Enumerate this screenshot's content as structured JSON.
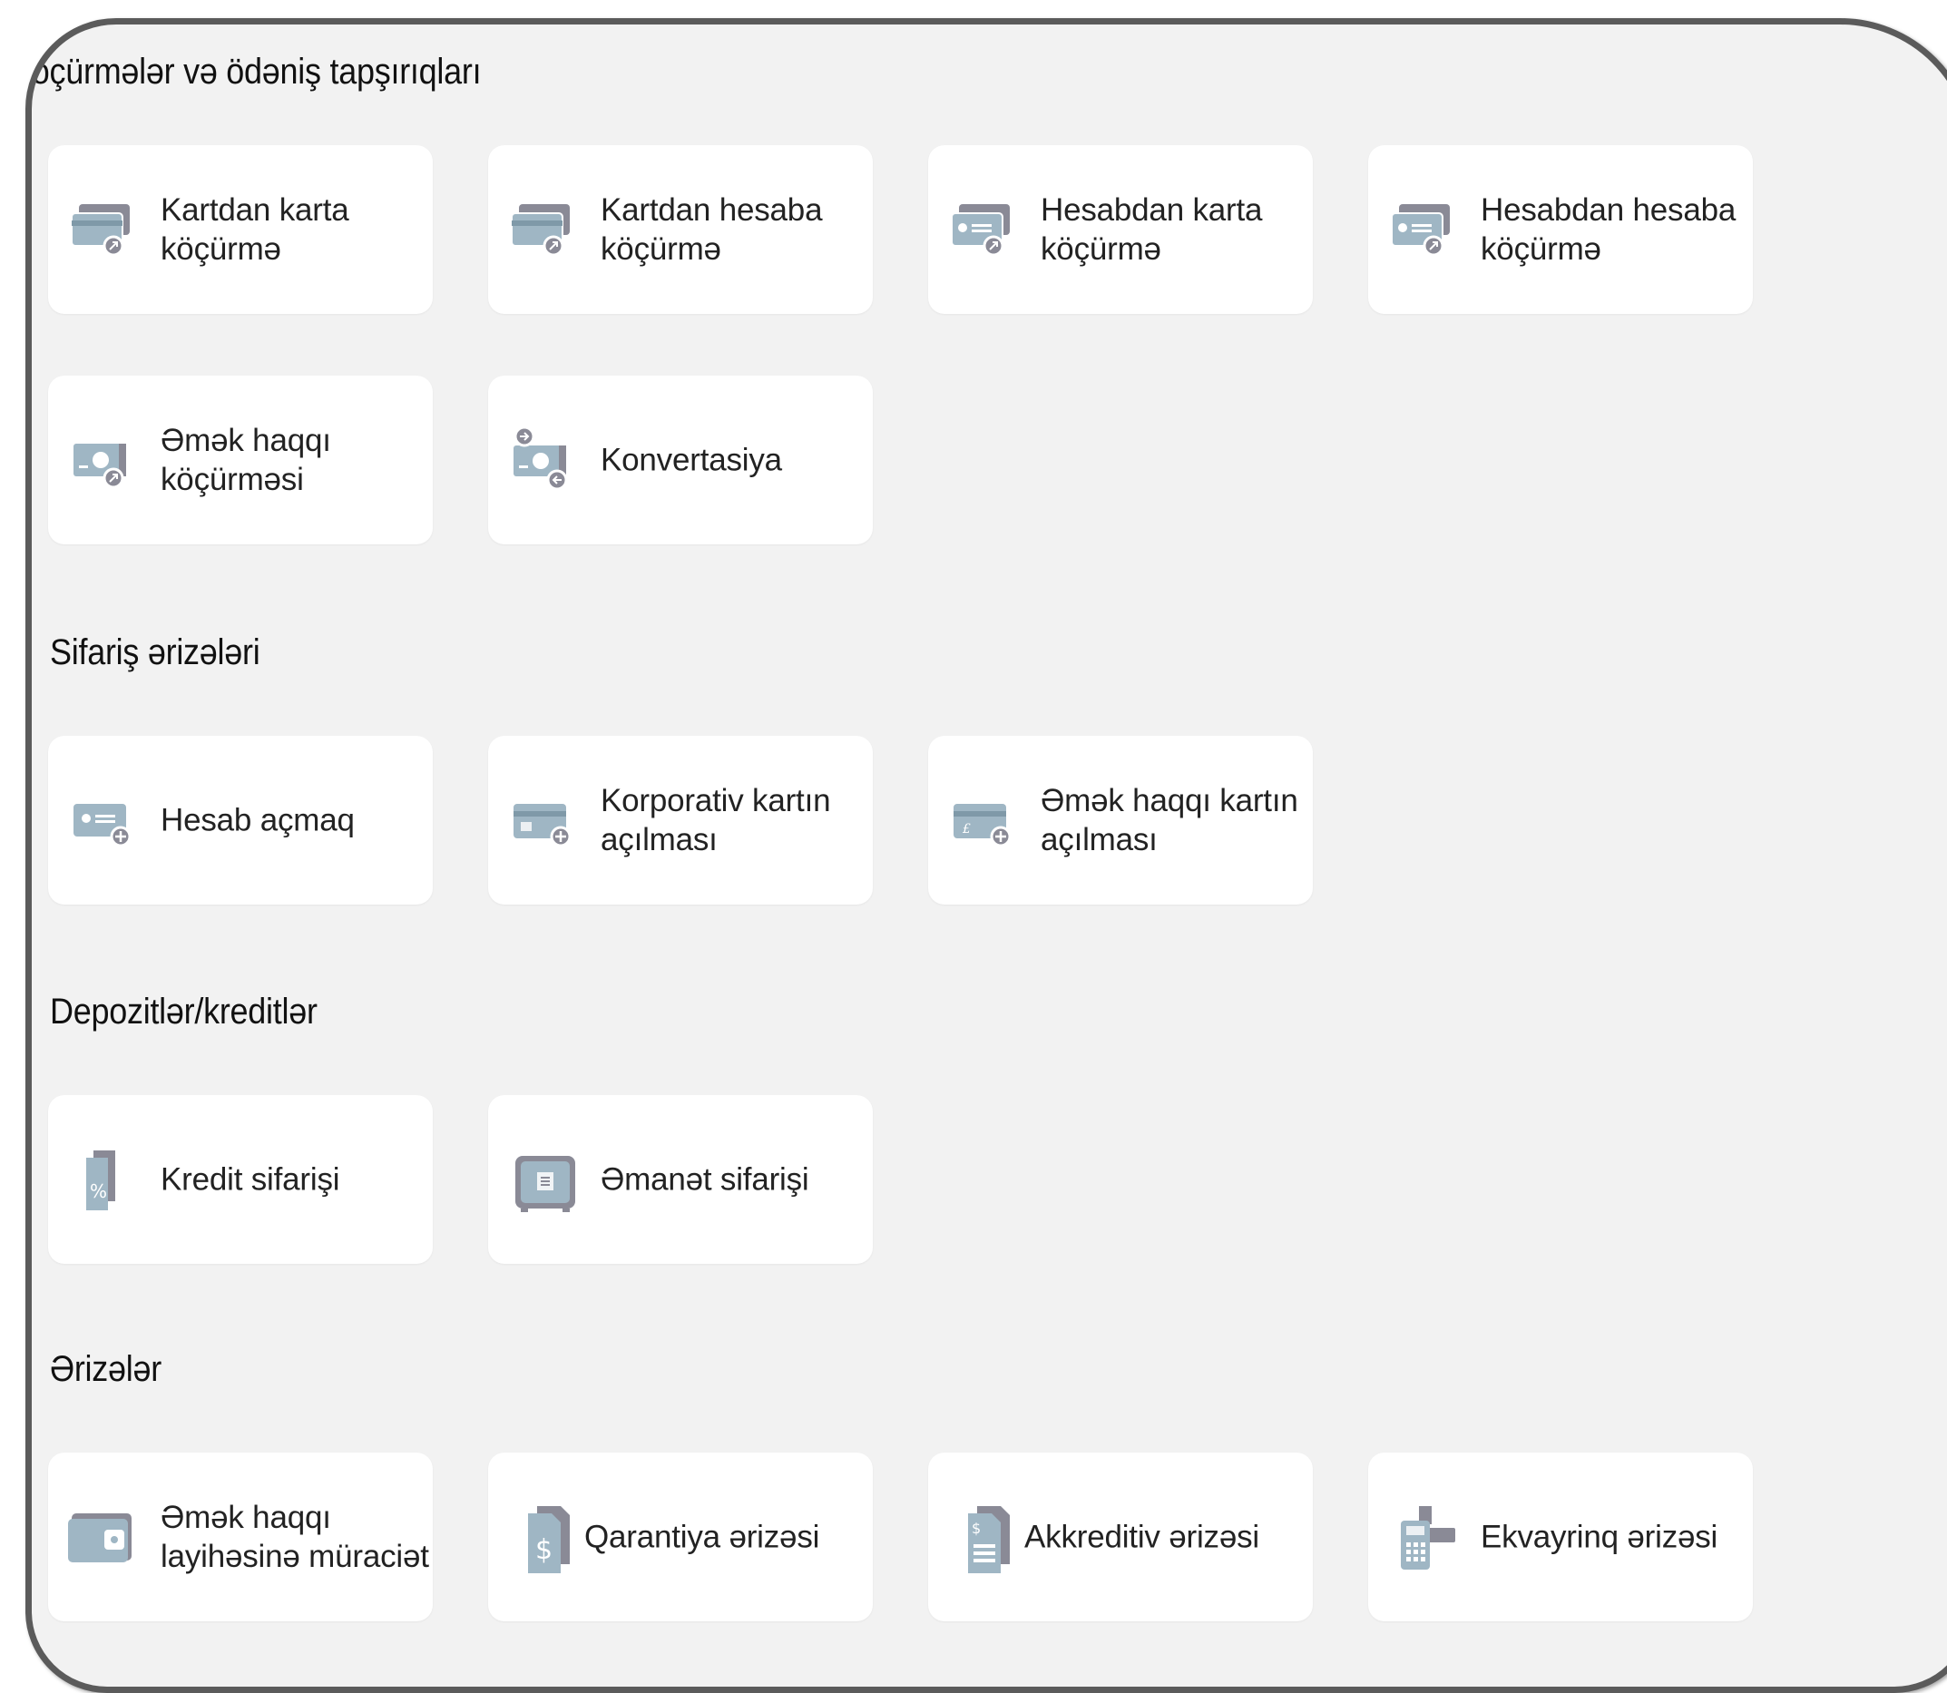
{
  "colors": {
    "background": "#f2f2f2",
    "card": "#ffffff",
    "icon_blue": "#9fb6c4",
    "icon_grey": "#8a8a96",
    "frame": "#5b5b5b"
  },
  "sections": [
    {
      "title": "Köçürmələr və ödəniş tapşırıqları",
      "items": [
        {
          "label": "Kartdan karta\nköçürmə",
          "icon": "card-transfer-icon"
        },
        {
          "label": "Kartdan hesaba\nköçürmə",
          "icon": "card-to-account-icon"
        },
        {
          "label": "Hesabdan karta\nköçürmə",
          "icon": "account-to-card-icon"
        },
        {
          "label": "Hesabdan hesaba\nköçürmə",
          "icon": "account-to-account-icon"
        },
        {
          "label": "Əmək haqqı\nköçürməsi",
          "icon": "salary-transfer-icon"
        },
        {
          "label": "Konvertasiya",
          "icon": "currency-exchange-icon"
        }
      ]
    },
    {
      "title": "Sifariş ərizələri",
      "items": [
        {
          "label": "Hesab açmaq",
          "icon": "open-account-icon"
        },
        {
          "label": "Korporativ kartın\naçılması",
          "icon": "corporate-card-icon"
        },
        {
          "label": "Əmək haqqı kartın\naçılması",
          "icon": "salary-card-icon"
        }
      ]
    },
    {
      "title": "Depozitlər/kreditlər",
      "items": [
        {
          "label": "Kredit sifarişi",
          "icon": "credit-percent-icon"
        },
        {
          "label": "Əmanət sifarişi",
          "icon": "safe-deposit-icon"
        }
      ]
    },
    {
      "title": "Ərizələr",
      "items": [
        {
          "label": "Əmək haqqı\nlayihəsinə müraciət",
          "icon": "wallet-icon"
        },
        {
          "label": "Qarantiya ərizəsi",
          "icon": "guarantee-document-icon"
        },
        {
          "label": "Akkreditiv ərizəsi",
          "icon": "letter-of-credit-icon"
        },
        {
          "label": "Ekvayrinq ərizəsi",
          "icon": "pos-terminal-icon"
        }
      ]
    }
  ]
}
